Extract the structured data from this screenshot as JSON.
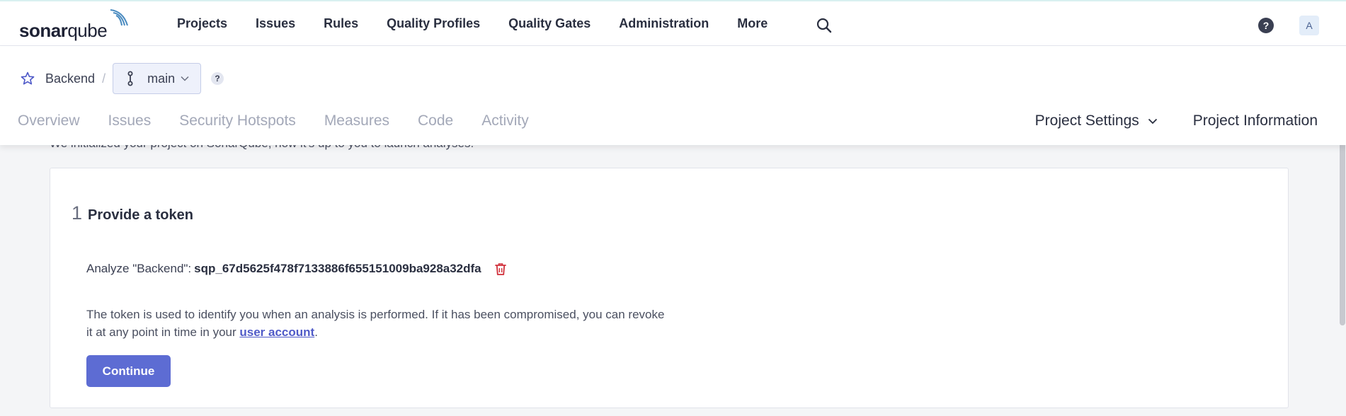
{
  "brand": {
    "logo_regular": "sonar",
    "logo_suffix": "qube"
  },
  "nav": {
    "items": [
      "Projects",
      "Issues",
      "Rules",
      "Quality Profiles",
      "Quality Gates",
      "Administration",
      "More"
    ]
  },
  "header": {
    "help_label": "?",
    "avatar_initial": "A"
  },
  "project": {
    "name": "Backend",
    "separator": "/",
    "branch": "main",
    "branch_help": "?",
    "tabs": [
      "Overview",
      "Issues",
      "Security Hotspots",
      "Measures",
      "Code",
      "Activity"
    ],
    "settings_label": "Project Settings",
    "info_label": "Project Information"
  },
  "main": {
    "intro_text": "We initialized your project on SonarQube, now it's up to you to launch analyses!",
    "step_number": "1",
    "step_title": "Provide a token",
    "token_label": "Analyze \"Backend\":",
    "token_value": "sqp_67d5625f478f7133886f655151009ba928a32dfa",
    "desc_before_link": "The token is used to identify you when an analysis is performed. If it has been compromised, you can revoke it at any point in time in your ",
    "desc_link": "user account",
    "desc_after_link": ".",
    "continue_label": "Continue"
  },
  "colors": {
    "accent": "#5d6cd3",
    "link": "#4f5ac8",
    "danger": "#d02f3a",
    "icon_brand": "#4a8bc0"
  },
  "icons": [
    "search-icon",
    "help-icon",
    "star-icon",
    "branch-icon",
    "chevron-down-icon",
    "trash-icon"
  ]
}
